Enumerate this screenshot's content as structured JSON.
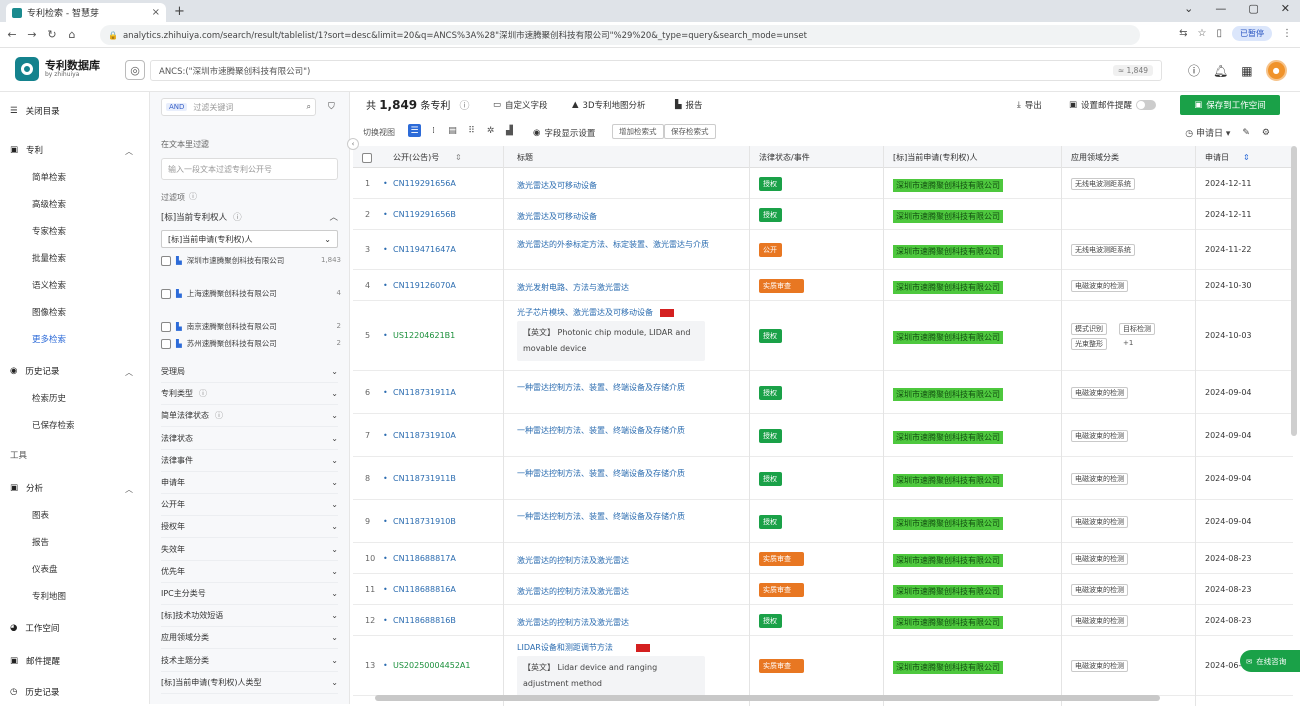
{
  "browser": {
    "tab_title": "专利检索 - 智慧芽",
    "tab_close": "×",
    "new_tab": "+",
    "url": "analytics.zhihuiya.com/search/result/tablelist/1?sort=desc&limit=20&q=ANCS%3A%28\"深圳市速腾聚创科技有限公司\"%29%20&_type=query&search_mode=unset",
    "profile": "已暂停",
    "window_buttons": [
      "⌄",
      "—",
      "▢",
      "✕"
    ],
    "nav": [
      "←",
      "→",
      "↻",
      "⌂"
    ]
  },
  "header": {
    "logo_title": "专利数据库",
    "logo_sub": "by zhihuiya",
    "query": "ANCS:(\"深圳市速腾聚创科技有限公司\")",
    "query_count": "≈ 1,849"
  },
  "sidebar": {
    "toggle_label": "关闭目录",
    "sections": [
      {
        "label": "专利",
        "items": [
          "简单检索",
          "高级检索",
          "专家检索",
          "批量检索",
          "语义检索",
          "图像检索",
          "更多检索"
        ]
      },
      {
        "label": "历史记录",
        "items": [
          "检索历史",
          "已保存检索"
        ]
      }
    ],
    "tools_label": "工具",
    "analysis": {
      "label": "分析",
      "items": [
        "图表",
        "报告",
        "仪表盘",
        "专利地图"
      ]
    },
    "bottom": [
      "工作空间",
      "邮件提醒",
      "历史记录"
    ]
  },
  "filter": {
    "and": "AND",
    "search_placeholder": "过滤关键词",
    "text_filter_label": "在文本里过滤",
    "text_input_placeholder": "输入一段文本过滤专利公开号",
    "filter_label": "过滤项",
    "assignee_section": "[标]当前专利权人",
    "assignee_select": "[标]当前申请(专利权)人",
    "assignees": [
      {
        "name": "深圳市速腾聚创科技有限公司",
        "count": "1,843"
      },
      {
        "name": "上海速腾聚创科技有限公司",
        "count": "4"
      },
      {
        "name": "南京速腾聚创科技有限公司",
        "count": "2"
      },
      {
        "name": "苏州速腾聚创科技有限公司",
        "count": "2"
      }
    ],
    "rows": [
      "受理局",
      "专利类型",
      "简单法律状态",
      "法律状态",
      "法律事件",
      "申请年",
      "公开年",
      "授权年",
      "失效年",
      "优先年",
      "IPC主分类号",
      "[标]技术功效短语",
      "应用领域分类",
      "技术主题分类",
      "[标]当前申请(专利权)人类型"
    ]
  },
  "toolbar": {
    "total_prefix": "共",
    "total": "1,849",
    "total_suffix": "条专利",
    "custom_fields": "自定义字段",
    "analysis_3d": "3D专利地图分析",
    "report": "报告",
    "export": "导出",
    "email_alert": "设置邮件提醒",
    "save_workspace": "保存到工作空间"
  },
  "viewbar": {
    "label": "切换视图",
    "display_settings": "字段显示设置",
    "tags": [
      "增加检索式",
      "保存检索式"
    ],
    "sort": "申请日"
  },
  "table": {
    "headers": [
      "公开(公告)号",
      "标题",
      "法律状态/事件",
      "[标]当前申请(专利权)人",
      "应用领域分类",
      "申请日"
    ],
    "rows": [
      {
        "i": "1",
        "pn": "CN119291656A",
        "title": "激光雷达及可移动设备",
        "status": "授权",
        "color": "#1aa148",
        "assignee": "深圳市速腾聚创科技有限公司",
        "tags": [
          "无线电波测距系统"
        ],
        "date": "2024-12-11"
      },
      {
        "i": "2",
        "pn": "CN119291656B",
        "title": "激光雷达及可移动设备",
        "status": "授权",
        "color": "#1aa148",
        "assignee": "深圳市速腾聚创科技有限公司",
        "tags": [],
        "date": "2024-12-11"
      },
      {
        "i": "3",
        "pn": "CN119471647A",
        "title": "激光雷达的外参标定方法、标定装置、激光雷达与介质",
        "status": "公开",
        "color": "#e87722",
        "assignee": "深圳市速腾聚创科技有限公司",
        "tags": [
          "无线电波测距系统"
        ],
        "date": "2024-11-22"
      },
      {
        "i": "4",
        "pn": "CN119126070A",
        "title": "激光发射电路、方法与激光雷达",
        "status": "实质审查",
        "color": "#e87722",
        "assignee": "深圳市速腾聚创科技有限公司",
        "tags": [
          "电磁波束的检测"
        ],
        "date": "2024-10-30"
      },
      {
        "i": "5",
        "pn": "US12204621B1",
        "title": "光子芯片模块、激光雷达及可移动设备",
        "abstract": "【英文】 Photonic chip module, LIDAR and movable device",
        "status": "授权",
        "color": "#1aa148",
        "assignee": "深圳市速腾聚创科技有限公司",
        "tags": [
          "模式识别",
          "目标检测",
          "光束整形"
        ],
        "more": "+1",
        "date": "2024-10-03"
      },
      {
        "i": "6",
        "pn": "CN118731911A",
        "title": "一种雷达控制方法、装置、终端设备及存储介质",
        "status": "授权",
        "color": "#1aa148",
        "assignee": "深圳市速腾聚创科技有限公司",
        "tags": [
          "电磁波束的检测"
        ],
        "date": "2024-09-04"
      },
      {
        "i": "7",
        "pn": "CN118731910A",
        "title": "一种雷达控制方法、装置、终端设备及存储介质",
        "status": "授权",
        "color": "#1aa148",
        "assignee": "深圳市速腾聚创科技有限公司",
        "tags": [
          "电磁波束的检测"
        ],
        "date": "2024-09-04"
      },
      {
        "i": "8",
        "pn": "CN118731911B",
        "title": "一种雷达控制方法、装置、终端设备及存储介质",
        "status": "授权",
        "color": "#1aa148",
        "assignee": "深圳市速腾聚创科技有限公司",
        "tags": [
          "电磁波束的检测"
        ],
        "date": "2024-09-04"
      },
      {
        "i": "9",
        "pn": "CN118731910B",
        "title": "一种雷达控制方法、装置、终端设备及存储介质",
        "status": "授权",
        "color": "#1aa148",
        "assignee": "深圳市速腾聚创科技有限公司",
        "tags": [
          "电磁波束的检测"
        ],
        "date": "2024-09-04"
      },
      {
        "i": "10",
        "pn": "CN118688817A",
        "title": "激光雷达的控制方法及激光雷达",
        "status": "实质审查",
        "color": "#e87722",
        "assignee": "深圳市速腾聚创科技有限公司",
        "tags": [
          "电磁波束的检测"
        ],
        "date": "2024-08-23"
      },
      {
        "i": "11",
        "pn": "CN118688816A",
        "title": "激光雷达的控制方法及激光雷达",
        "status": "实质审查",
        "color": "#e87722",
        "assignee": "深圳市速腾聚创科技有限公司",
        "tags": [
          "电磁波束的检测"
        ],
        "date": "2024-08-23"
      },
      {
        "i": "12",
        "pn": "CN118688816B",
        "title": "激光雷达的控制方法及激光雷达",
        "status": "授权",
        "color": "#1aa148",
        "assignee": "深圳市速腾聚创科技有限公司",
        "tags": [
          "电磁波束的检测"
        ],
        "date": "2024-08-23"
      },
      {
        "i": "13",
        "pn": "US20250004452A1",
        "title": "LIDAR设备和测距调节方法",
        "abstract": "【英文】 Lidar device and ranging adjustment method",
        "status": "实质审查",
        "color": "#e87722",
        "assignee": "深圳市速腾聚创科技有限公司",
        "tags": [
          "电磁波束的检测"
        ],
        "date": "2024-06-"
      }
    ]
  },
  "chat": "在线咨询"
}
